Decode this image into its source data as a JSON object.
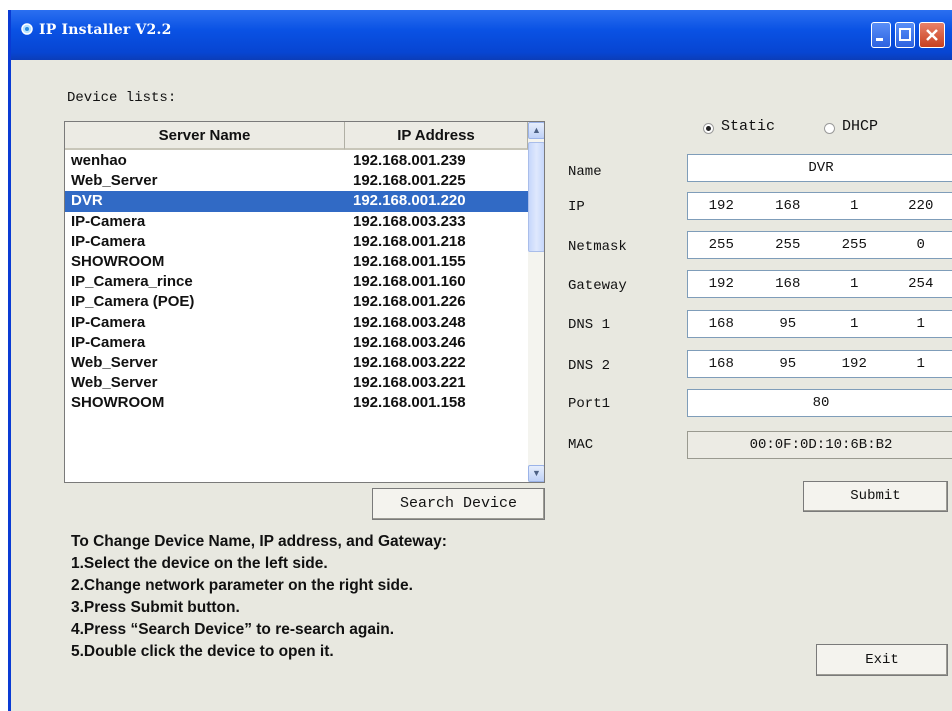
{
  "window": {
    "title": "IP Installer V2.2"
  },
  "device_list": {
    "label": "Device lists:",
    "columns": [
      "Server Name",
      "IP Address"
    ],
    "rows": [
      {
        "name": "wenhao",
        "ip": "192.168.001.239"
      },
      {
        "name": "Web_Server",
        "ip": "192.168.001.225"
      },
      {
        "name": "DVR",
        "ip": "192.168.001.220",
        "selected": true
      },
      {
        "name": "IP-Camera",
        "ip": "192.168.003.233"
      },
      {
        "name": "IP-Camera",
        "ip": "192.168.001.218"
      },
      {
        "name": "SHOWROOM",
        "ip": "192.168.001.155"
      },
      {
        "name": "IP_Camera_rince",
        "ip": "192.168.001.160"
      },
      {
        "name": "IP_Camera (POE)",
        "ip": "192.168.001.226"
      },
      {
        "name": "IP-Camera",
        "ip": "192.168.003.248"
      },
      {
        "name": "IP-Camera",
        "ip": "192.168.003.246"
      },
      {
        "name": "Web_Server",
        "ip": "192.168.003.222"
      },
      {
        "name": "Web_Server",
        "ip": "192.168.003.221"
      },
      {
        "name": "SHOWROOM",
        "ip": "192.168.001.158"
      }
    ]
  },
  "mode": {
    "static_label": "Static",
    "dhcp_label": "DHCP",
    "selected": "Static"
  },
  "settings": {
    "name_label": "Name",
    "name_value": "DVR",
    "ip_label": "IP",
    "ip": [
      "192",
      "168",
      "1",
      "220"
    ],
    "netmask_label": "Netmask",
    "netmask": [
      "255",
      "255",
      "255",
      "0"
    ],
    "gateway_label": "Gateway",
    "gateway": [
      "192",
      "168",
      "1",
      "254"
    ],
    "dns1_label": "DNS 1",
    "dns1": [
      "168",
      "95",
      "1",
      "1"
    ],
    "dns2_label": "DNS 2",
    "dns2": [
      "168",
      "95",
      "192",
      "1"
    ],
    "port_label": "Port1",
    "port_value": "80",
    "mac_label": "MAC",
    "mac_value": "00:0F:0D:10:6B:B2"
  },
  "buttons": {
    "search": "Search Device",
    "submit": "Submit",
    "exit": "Exit"
  },
  "instructions": [
    "To Change Device Name, IP address, and Gateway:",
    "1.Select the device on the left side.",
    "2.Change network parameter on the right side.",
    "3.Press Submit button.",
    "4.Press “Search Device” to re-search again.",
    "5.Double click the device to open it."
  ],
  "colors": {
    "titlebar": "#0a52e4",
    "selection": "#316ac5",
    "window_bg": "#e8e8e0"
  }
}
